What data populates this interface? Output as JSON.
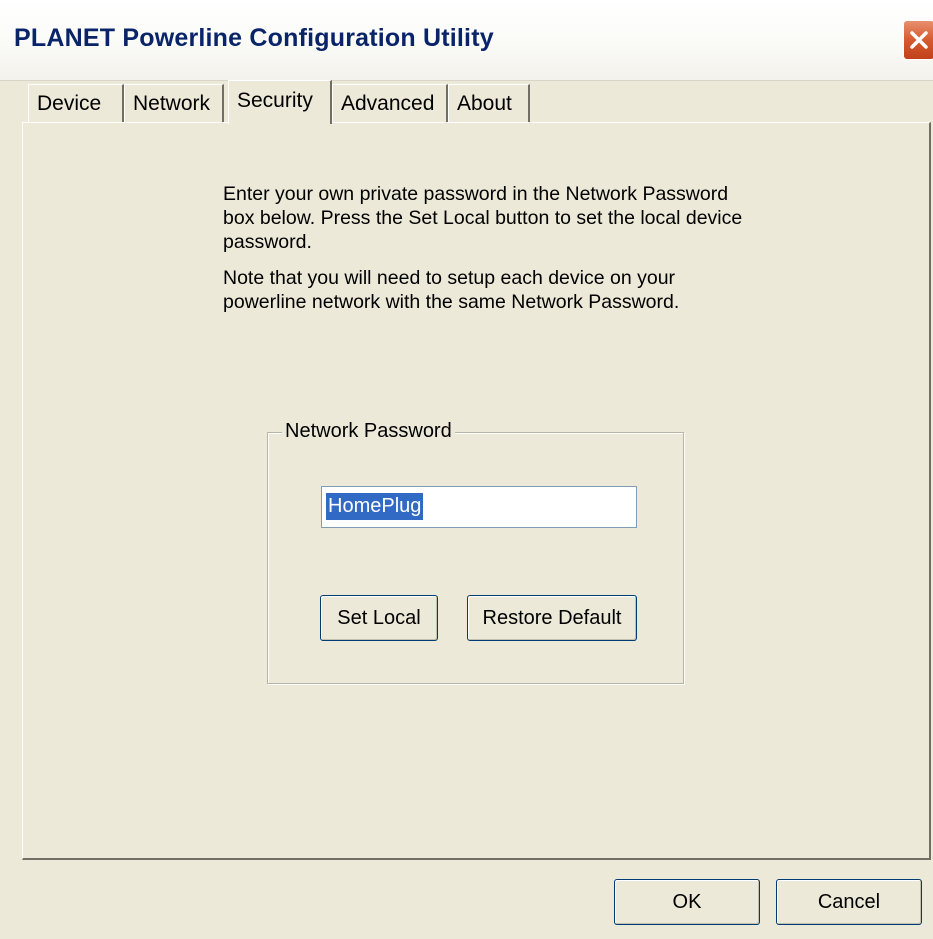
{
  "window": {
    "title": "PLANET Powerline Configuration Utility"
  },
  "tabs": [
    {
      "label": "Device"
    },
    {
      "label": "Network"
    },
    {
      "label": "Security",
      "active": true
    },
    {
      "label": "Advanced"
    },
    {
      "label": "About"
    }
  ],
  "security": {
    "instruction_1": "Enter your own private password in the Network Password box below. Press the Set Local button to set the local device password.",
    "instruction_2": "Note that you will need to setup each device on your powerline network with the same Network Password.",
    "group_label": "Network Password",
    "password_value": "HomePlug",
    "set_local_label": "Set Local",
    "restore_default_label": "Restore Default"
  },
  "footer": {
    "ok_label": "OK",
    "cancel_label": "Cancel"
  },
  "colors": {
    "title_text": "#0a246a",
    "close_button": "#d65a30",
    "selection": "#316ac5"
  }
}
